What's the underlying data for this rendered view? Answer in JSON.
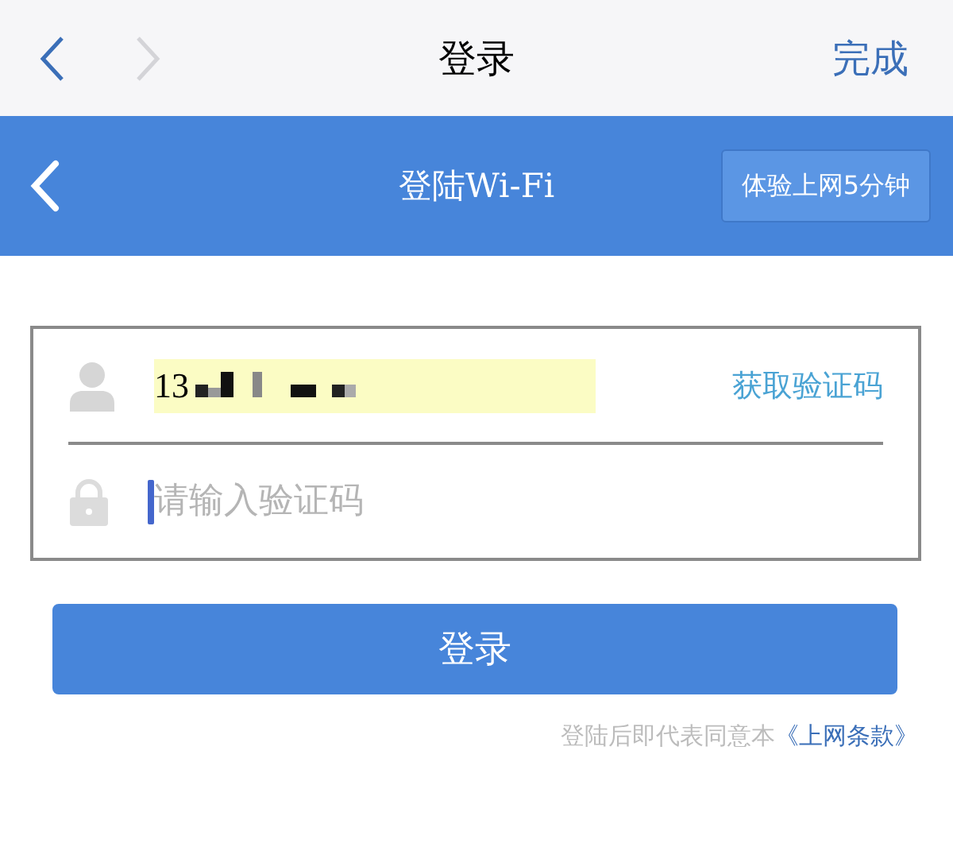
{
  "nav_bar": {
    "back": {
      "disabled": false
    },
    "forward": {
      "disabled": true
    },
    "title": "登录",
    "done": "完成"
  },
  "header": {
    "title": "登陆Wi-Fi",
    "trial_button": "体验上网5分钟"
  },
  "form": {
    "phone": {
      "value": "13",
      "autofilled": true,
      "masked": true
    },
    "get_code": "获取验证码",
    "code": {
      "placeholder": "请输入验证码",
      "focused": true
    }
  },
  "login_button": "登录",
  "agreement": {
    "text": "登陆后即代表同意本",
    "link": "《上网条款》"
  }
}
